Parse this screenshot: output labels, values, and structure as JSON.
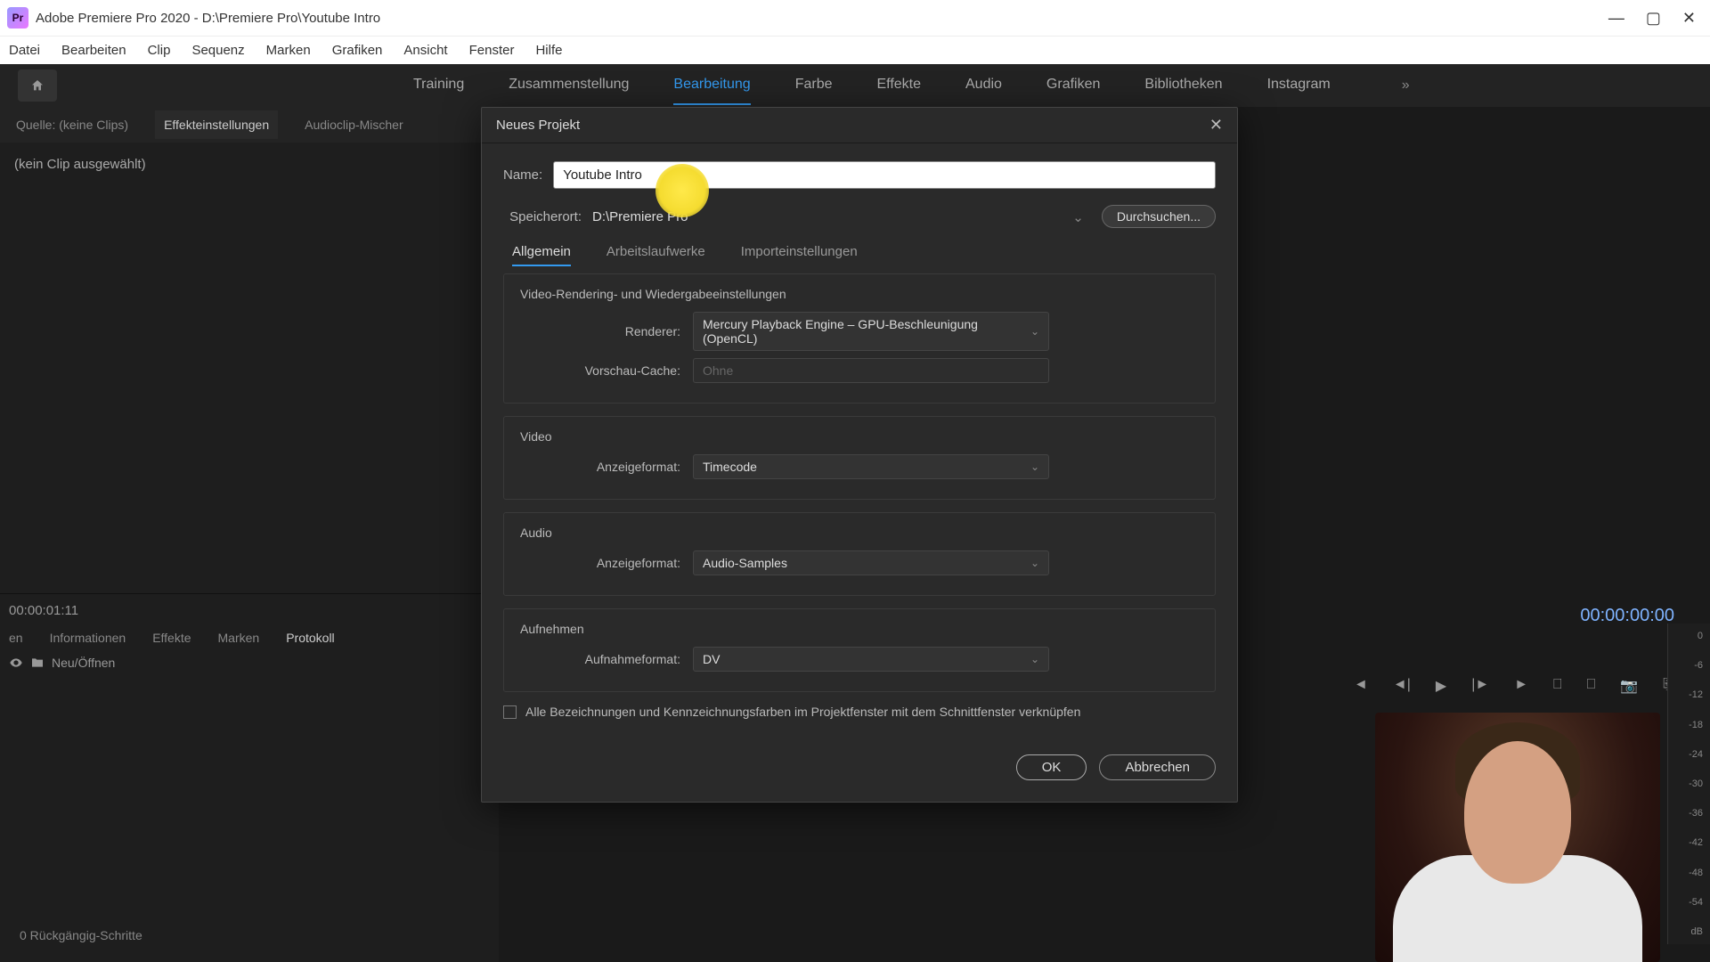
{
  "titlebar": {
    "app_icon_text": "Pr",
    "title": "Adobe Premiere Pro 2020 - D:\\Premiere Pro\\Youtube Intro"
  },
  "menu": {
    "items": [
      "Datei",
      "Bearbeiten",
      "Clip",
      "Sequenz",
      "Marken",
      "Grafiken",
      "Ansicht",
      "Fenster",
      "Hilfe"
    ]
  },
  "workspaces": {
    "items": [
      "Training",
      "Zusammenstellung",
      "Bearbeitung",
      "Farbe",
      "Effekte",
      "Audio",
      "Grafiken",
      "Bibliotheken",
      "Instagram"
    ],
    "active_index": 2,
    "more": "»"
  },
  "source_panel": {
    "tabs": [
      "Quelle: (keine Clips)",
      "Effekteinstellungen",
      "Audioclip-Mischer"
    ],
    "no_clip": "(kein Clip ausgewählt)"
  },
  "project_panel": {
    "timecode": "00:00:01:11",
    "tabs": [
      "en",
      "Informationen",
      "Effekte",
      "Marken",
      "Protokoll"
    ],
    "active_tab_index": 4,
    "new_open": "Neu/Öffnen",
    "undo_steps": "0 Rückgängig-Schritte"
  },
  "program": {
    "timecode": "00:00:00:00"
  },
  "audio_meter": {
    "ticks": [
      "0",
      "-6",
      "-12",
      "-18",
      "-24",
      "-30",
      "-36",
      "-42",
      "-48",
      "-54",
      "dB"
    ]
  },
  "dialog": {
    "title": "Neues Projekt",
    "name_label": "Name:",
    "name_value": "Youtube Intro",
    "location_label": "Speicherort:",
    "location_value": "D:\\Premiere Pro",
    "browse": "Durchsuchen...",
    "tabs": [
      "Allgemein",
      "Arbeitslaufwerke",
      "Importeinstellungen"
    ],
    "active_tab": 0,
    "group_rendering": {
      "title": "Video-Rendering- und Wiedergabeeinstellungen",
      "renderer_label": "Renderer:",
      "renderer_value": "Mercury Playback Engine – GPU-Beschleunigung (OpenCL)",
      "cache_label": "Vorschau-Cache:",
      "cache_value": "Ohne"
    },
    "group_video": {
      "title": "Video",
      "format_label": "Anzeigeformat:",
      "format_value": "Timecode"
    },
    "group_audio": {
      "title": "Audio",
      "format_label": "Anzeigeformat:",
      "format_value": "Audio-Samples"
    },
    "group_capture": {
      "title": "Aufnehmen",
      "format_label": "Aufnahmeformat:",
      "format_value": "DV"
    },
    "checkbox_label": "Alle Bezeichnungen und Kennzeichnungsfarben im Projektfenster mit dem Schnittfenster verknüpfen",
    "ok": "OK",
    "cancel": "Abbrechen"
  }
}
